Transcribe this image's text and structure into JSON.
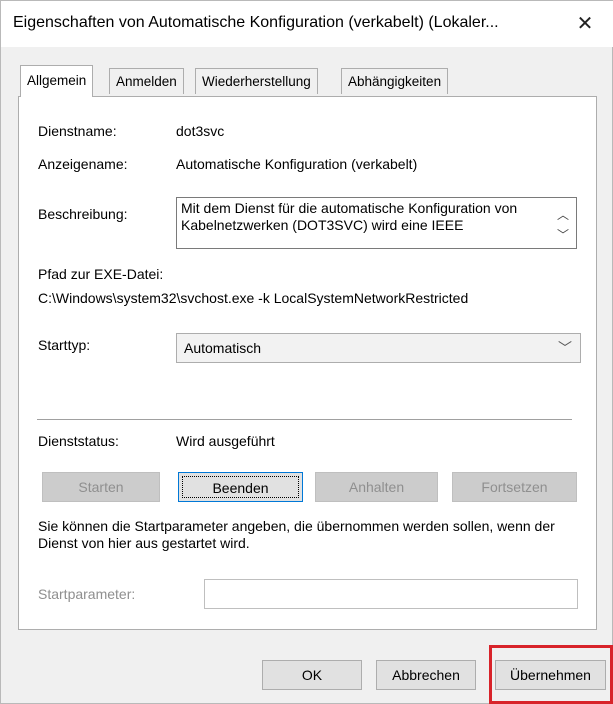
{
  "window": {
    "title": "Eigenschaften von Automatische Konfiguration (verkabelt) (Lokaler...",
    "close_glyph": "✕"
  },
  "tabs": [
    {
      "label": "Allgemein",
      "active": true
    },
    {
      "label": "Anmelden",
      "active": false
    },
    {
      "label": "Wiederherstellung",
      "active": false
    },
    {
      "label": "Abhängigkeiten",
      "active": false
    }
  ],
  "general": {
    "service_name_label": "Dienstname:",
    "service_name_value": "dot3svc",
    "display_name_label": "Anzeigename:",
    "display_name_value": "Automatische Konfiguration (verkabelt)",
    "description_label": "Beschreibung:",
    "description_value": "Mit dem Dienst für die automatische Konfiguration von Kabelnetzwerken (DOT3SVC) wird eine IEEE",
    "path_label": "Pfad zur EXE-Datei:",
    "path_value": "C:\\Windows\\system32\\svchost.exe -k LocalSystemNetworkRestricted",
    "starttype_label": "Starttyp:",
    "starttype_value": "Automatisch",
    "status_label": "Dienststatus:",
    "status_value": "Wird ausgeführt",
    "buttons": {
      "start": "Starten",
      "stop": "Beenden",
      "pause": "Anhalten",
      "resume": "Fortsetzen"
    },
    "param_hint": "Sie können die Startparameter angeben, die übernommen werden sollen, wenn der Dienst von hier aus gestartet wird.",
    "param_label": "Startparameter:",
    "param_value": ""
  },
  "footer": {
    "ok": "OK",
    "cancel": "Abbrechen",
    "apply": "Übernehmen"
  },
  "colors": {
    "highlight": "#d8232a",
    "focus": "#0078d7"
  }
}
